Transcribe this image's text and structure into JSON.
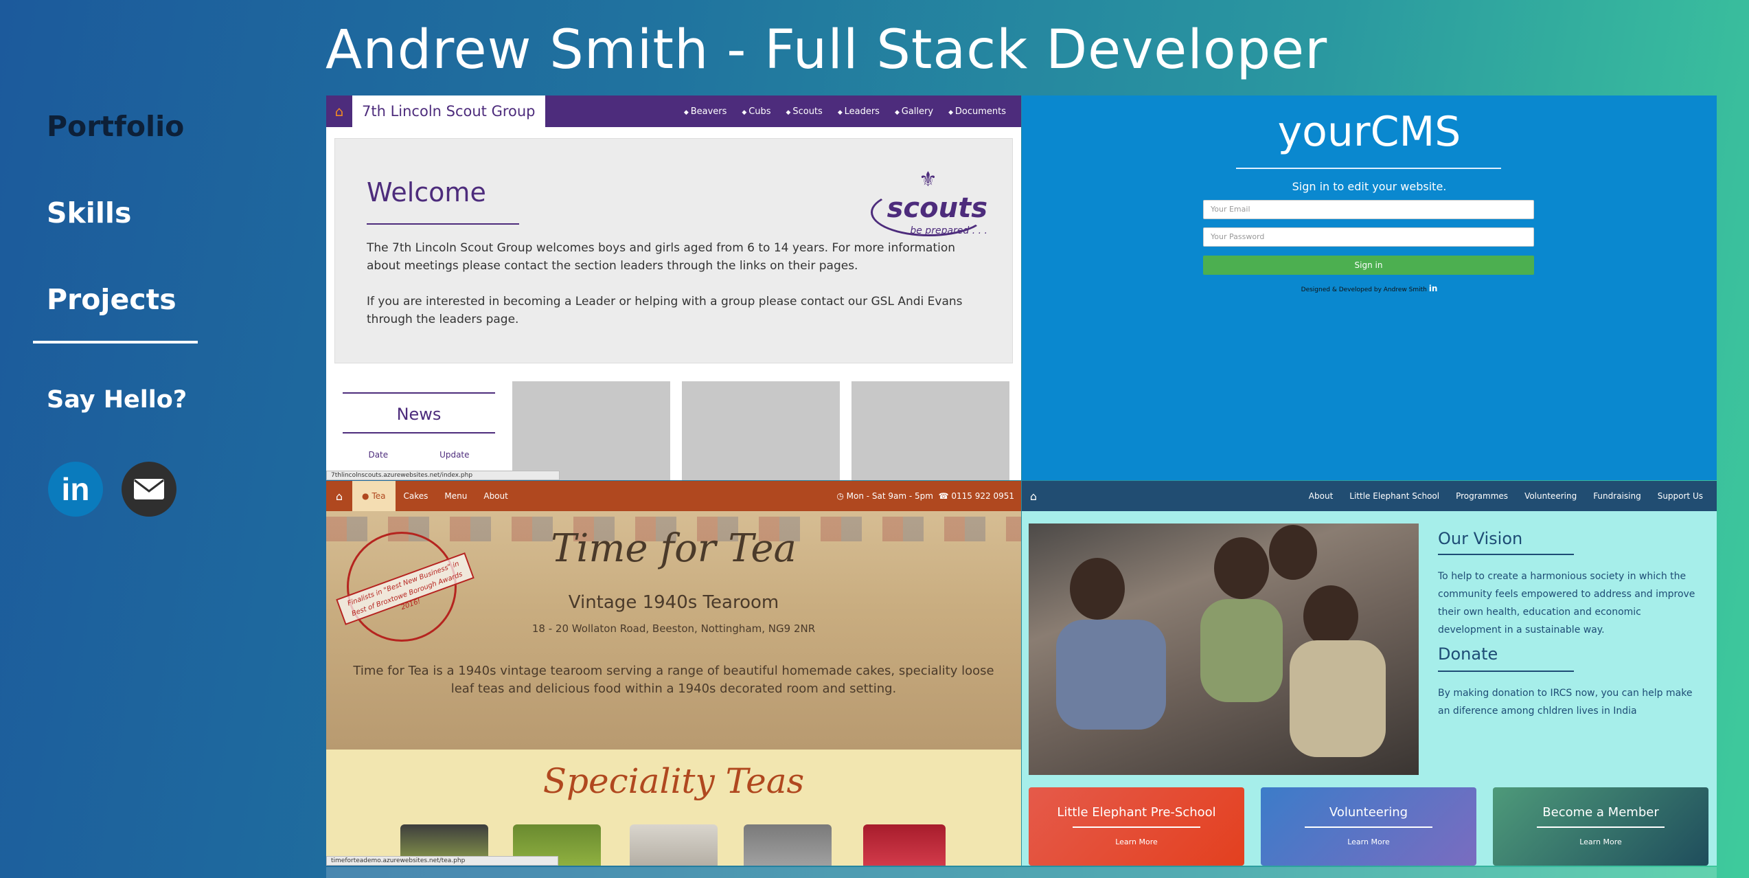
{
  "header": {
    "title": "Andrew Smith - Full Stack Developer"
  },
  "nav": {
    "portfolio": "Portfolio",
    "skills": "Skills",
    "projects": "Projects",
    "say_hello": "Say Hello?"
  },
  "social": {
    "linkedin": "in"
  },
  "scouts": {
    "brand": "7th Lincoln Scout Group",
    "menu": [
      "Beavers",
      "Cubs",
      "Scouts",
      "Leaders",
      "Gallery",
      "Documents"
    ],
    "welcome": "Welcome",
    "para1": "The 7th Lincoln Scout Group welcomes boys and girls aged from 6 to 14 years. For more information about meetings please contact the section leaders through the links on their pages.",
    "para2": "If you are interested in becoming a Leader or helping with a group please contact our GSL Andi Evans through the leaders page.",
    "logo_main": "scouts",
    "logo_sub": "be prepared . . .",
    "news": "News",
    "news_cols": [
      "Date",
      "Update"
    ],
    "status_url": "7thlincolnscouts.azurewebsites.net/index.php"
  },
  "cms": {
    "title": "yourCMS",
    "subtitle": "Sign in to edit your website.",
    "email_placeholder": "Your Email",
    "password_placeholder": "Your Password",
    "signin": "Sign in",
    "footer": "Designed & Developed by Andrew Smith"
  },
  "tea": {
    "menu_active": "Tea",
    "menu": [
      "Cakes",
      "Menu",
      "About"
    ],
    "hours": "Mon - Sat 9am - 5pm",
    "phone": "0115 922 0951",
    "stamp": "Finalists in \"Best New Business\" in Best of Broxtowe Borough Awards 2016!",
    "script_title": "Time for Tea",
    "subtitle": "Vintage 1940s Tearoom",
    "address": "18 - 20 Wollaton Road, Beeston, Nottingham, NG9 2NR",
    "description": "Time for Tea is a 1940s vintage tearoom serving a range of beautiful homemade cakes, speciality loose leaf teas and delicious food within a 1940s decorated room and setting.",
    "speciality": "Speciality Teas",
    "status_url": "timeforteademo.azurewebsites.net/tea.php"
  },
  "elephant": {
    "menu": [
      "About",
      "Little Elephant School",
      "Programmes",
      "Volunteering",
      "Fundraising",
      "Support Us"
    ],
    "vision_title": "Our Vision",
    "vision_text": "To help to create a harmonious society in which the community feels empowered to address and improve their own health, education and economic development in a sustainable way.",
    "donate_title": "Donate",
    "donate_text": "By making donation to IRCS now, you can help make an diference among chldren lives in India",
    "cards": [
      {
        "title": "Little Elephant Pre-School",
        "link": "Learn More"
      },
      {
        "title": "Volunteering",
        "link": "Learn More"
      },
      {
        "title": "Become a Member",
        "link": "Learn More"
      }
    ]
  },
  "colors": {
    "scouts_purple": "#4d2c7c",
    "cms_blue": "#0a88cf",
    "tea_rust": "#b0481f",
    "elephant_navy": "#214d72",
    "elephant_aqua": "#a6eeea"
  }
}
